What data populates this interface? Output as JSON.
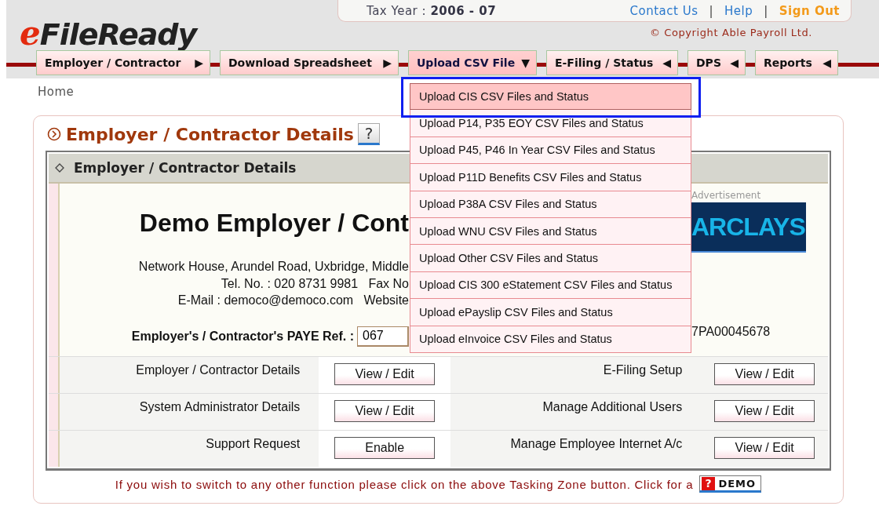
{
  "header": {
    "logo": {
      "prefix": "e",
      "name": "FileReady"
    },
    "tax_year": "Tax Year : **2006 - 07**",
    "links": [
      {
        "kind": "link",
        "label": "Contact Us"
      },
      {
        "kind": "separator",
        "label": "|"
      },
      {
        "kind": "link",
        "label": "Help"
      },
      {
        "kind": "separator",
        "label": "|"
      },
      {
        "kind": "signout",
        "label": "Sign Out"
      }
    ],
    "copyright": "© Copyright Able Payroll Ltd."
  },
  "tabs": [
    {
      "label": "Employer / Contractor",
      "arrow": "▶",
      "selected": false
    },
    {
      "label": "Download Spreadsheet",
      "arrow": "▶",
      "selected": false
    },
    {
      "label": "Upload CSV File",
      "arrow": "▼",
      "selected": true
    },
    {
      "label": "E-Filing / Status",
      "arrow": "◀",
      "selected": false
    },
    {
      "label": "DPS",
      "arrow": "◀",
      "selected": false
    },
    {
      "label": "Reports",
      "arrow": "◀",
      "selected": false
    }
  ],
  "dropdown": [
    {
      "label": "Upload CIS CSV Files and Status",
      "selected": true
    },
    {
      "label": "Upload P14, P35 EOY CSV Files and Status",
      "selected": false
    },
    {
      "label": "Upload P45, P46 In Year CSV Files and Status",
      "selected": false
    },
    {
      "label": "Upload P11D Benefits CSV Files and Status",
      "selected": false
    },
    {
      "label": "Upload P38A CSV Files and Status",
      "selected": false
    },
    {
      "label": "Upload WNU CSV Files and Status",
      "selected": false
    },
    {
      "label": "Upload Other CSV Files and Status",
      "selected": false
    },
    {
      "label": "Upload CIS 300 eStatement CSV Files and Status",
      "selected": false
    },
    {
      "label": "Upload ePayslip CSV Files and Status",
      "selected": false
    },
    {
      "label": "Upload eInvoice CSV Files and Status",
      "selected": false
    }
  ],
  "breadcrumb": "Home",
  "panel": {
    "title": "Employer / Contractor Details",
    "help": "?",
    "section_title": "Employer / Contractor Details",
    "company": "Demo Employer / Cont",
    "address_lines": [
      "Network House, Arundel Road, Uxbridge, Middle",
      "Tel. No. : 020 8731 9981   Fax No",
      "E-Mail : democo@democo.com   Website"
    ],
    "paye_label": "Employer's / Contractor's PAYE Ref. :",
    "paye_value": "067",
    "advert_label": "Advertisement",
    "advert_text": "ARCLAYS",
    "reference": "7PA00045678",
    "rows": [
      {
        "label_1": "Employer / Contractor Details",
        "button_1": "View / Edit",
        "label_2": "E-Filing Setup",
        "button_2": "View / Edit"
      },
      {
        "label_1": "System Administrator Details",
        "button_1": "View / Edit",
        "label_2": "Manage Additional Users",
        "button_2": "View / Edit"
      },
      {
        "label_1": "Support Request",
        "button_1": "Enable",
        "label_2": "Manage Employee Internet A/c",
        "button_2": "View / Edit"
      }
    ],
    "footer": "If you wish to switch to any other function please click on the above Tasking Zone button. Click for a",
    "demo": {
      "mark": "?",
      "label": "DEMO"
    }
  }
}
